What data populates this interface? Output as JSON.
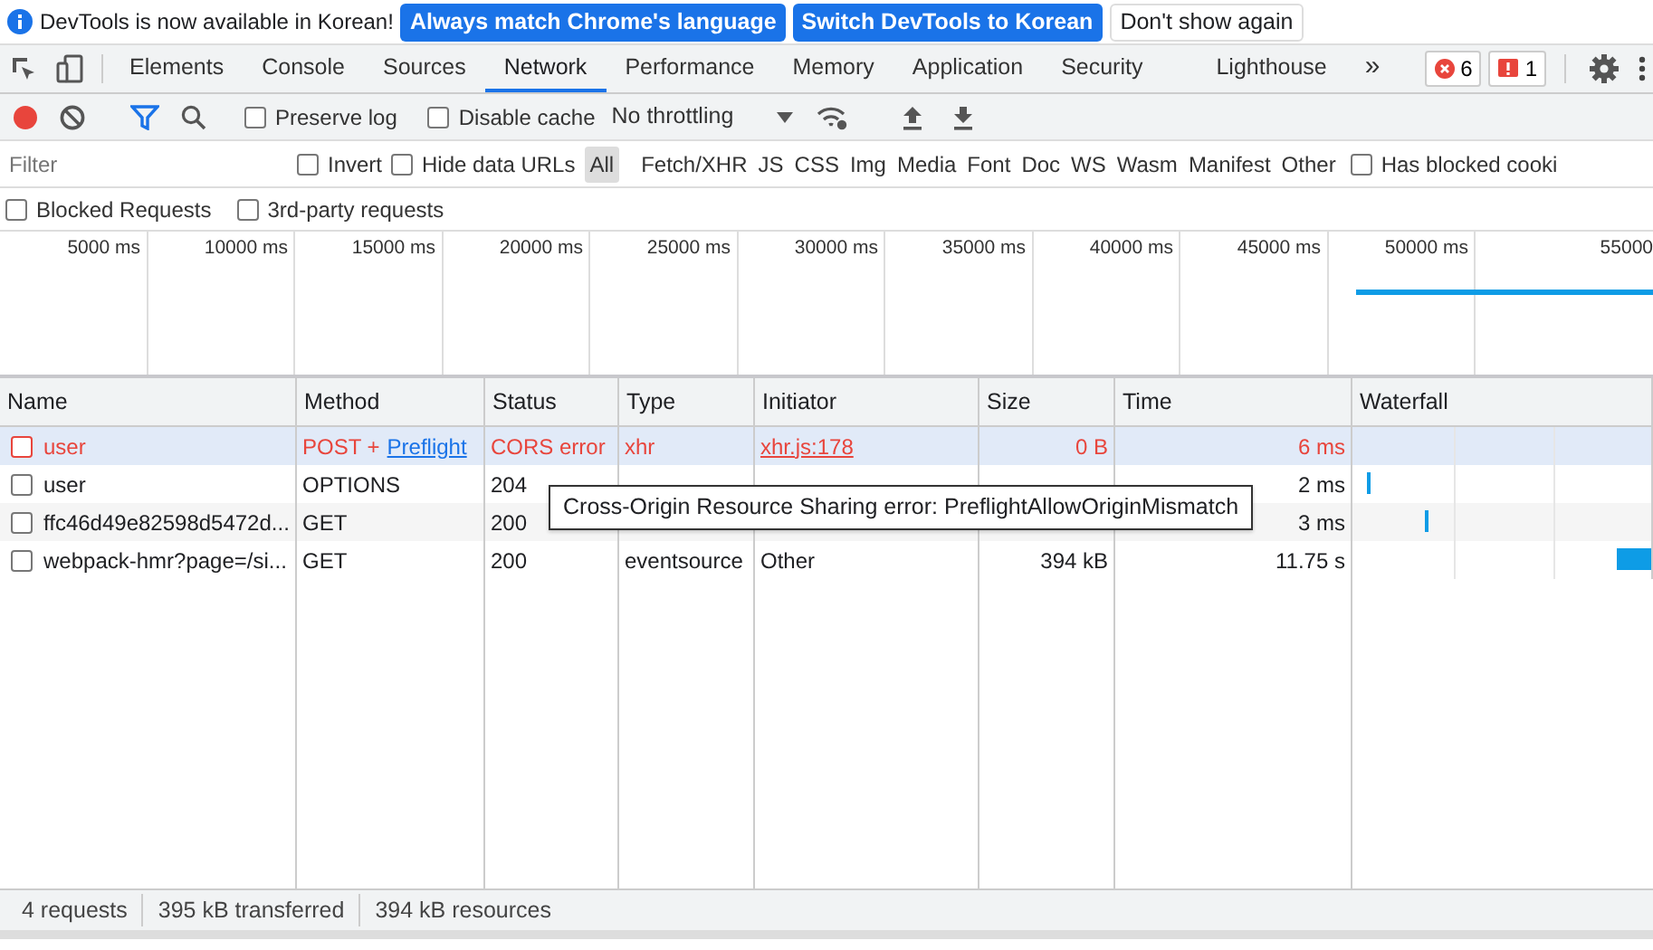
{
  "banner": {
    "message": "DevTools is now available in Korean!",
    "buttons": [
      {
        "label": "Always match Chrome's language",
        "kind": "primary"
      },
      {
        "label": "Switch DevTools to Korean",
        "kind": "primary"
      },
      {
        "label": "Don't show again",
        "kind": "plain"
      }
    ]
  },
  "tabs": [
    {
      "label": "Elements",
      "selected": false
    },
    {
      "label": "Console",
      "selected": false
    },
    {
      "label": "Sources",
      "selected": false
    },
    {
      "label": "Network",
      "selected": true
    },
    {
      "label": "Performance",
      "selected": false
    },
    {
      "label": "Memory",
      "selected": false
    },
    {
      "label": "Application",
      "selected": false
    },
    {
      "label": "Security",
      "selected": false
    },
    {
      "label": "Lighthouse",
      "selected": false
    }
  ],
  "more_tabs": "»",
  "counters": [
    {
      "kind": "error",
      "count": "6"
    },
    {
      "kind": "issue",
      "count": "1"
    }
  ],
  "toolbar": {
    "recording": true,
    "preserve_log": {
      "label": "Preserve log",
      "checked": false
    },
    "disable_cache": {
      "label": "Disable cache",
      "checked": false
    },
    "throttling": "No throttling"
  },
  "filter": {
    "placeholder": "Filter",
    "invert": {
      "label": "Invert",
      "checked": false
    },
    "hide_data_urls": {
      "label": "Hide data URLs",
      "checked": false
    },
    "types": [
      {
        "label": "All",
        "selected": true
      },
      {
        "label": "Fetch/XHR",
        "selected": false
      },
      {
        "label": "JS",
        "selected": false
      },
      {
        "label": "CSS",
        "selected": false
      },
      {
        "label": "Img",
        "selected": false
      },
      {
        "label": "Media",
        "selected": false
      },
      {
        "label": "Font",
        "selected": false
      },
      {
        "label": "Doc",
        "selected": false
      },
      {
        "label": "WS",
        "selected": false
      },
      {
        "label": "Wasm",
        "selected": false
      },
      {
        "label": "Manifest",
        "selected": false
      },
      {
        "label": "Other",
        "selected": false
      }
    ],
    "has_blocked_cookies": {
      "label": "Has blocked cooki",
      "checked": false
    },
    "blocked_requests": {
      "label": "Blocked Requests",
      "checked": false
    },
    "third_party": {
      "label": "3rd-party requests",
      "checked": false
    }
  },
  "overview": {
    "ticks": [
      "5000 ms",
      "10000 ms",
      "15000 ms",
      "20000 ms",
      "25000 ms",
      "30000 ms",
      "35000 ms",
      "40000 ms",
      "45000 ms",
      "50000 ms",
      "55000"
    ]
  },
  "table": {
    "columns": [
      "Name",
      "Method",
      "Status",
      "Type",
      "Initiator",
      "Size",
      "Time",
      "Waterfall"
    ],
    "rows": [
      {
        "name": "user",
        "method": "POST +",
        "method_link": "Preflight",
        "status": "CORS error",
        "type": "xhr",
        "initiator": "xhr.js:178",
        "initiator_link": true,
        "size": "0 B",
        "time": "6 ms",
        "error": true,
        "selected": true
      },
      {
        "name": "user",
        "method": "OPTIONS",
        "status": "204",
        "time": "2 ms",
        "error": false,
        "selected": false
      },
      {
        "name": "ffc46d49e82598d5472d...",
        "method": "GET",
        "status": "200",
        "time": "3 ms",
        "error": false,
        "selected": false
      },
      {
        "name": "webpack-hmr?page=/si...",
        "method": "GET",
        "status": "200",
        "type": "eventsource",
        "initiator": "Other",
        "initiator_link": false,
        "size": "394 kB",
        "time": "11.75 s",
        "error": false,
        "selected": false
      }
    ]
  },
  "tooltip": "Cross-Origin Resource Sharing error: PreflightAllowOriginMismatch",
  "status_bar": [
    "4 requests",
    "395 kB transferred",
    "394 kB resources"
  ]
}
